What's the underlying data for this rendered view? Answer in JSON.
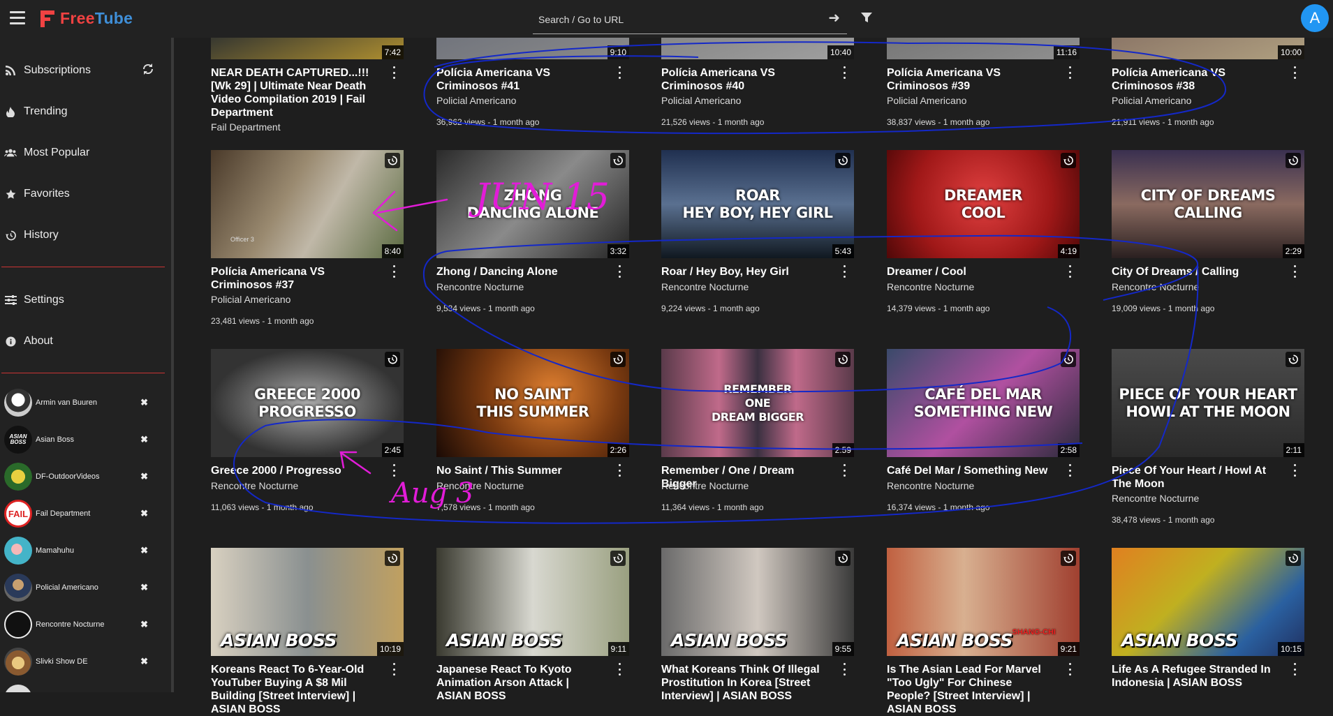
{
  "app": {
    "name_part1": "Free",
    "name_part2": "Tube"
  },
  "header": {
    "search_placeholder": "Search / Go to URL",
    "avatar_letter": "A"
  },
  "sidebar": {
    "nav": [
      {
        "label": "Subscriptions",
        "icon": "rss-icon"
      },
      {
        "label": "Trending",
        "icon": "fire-icon"
      },
      {
        "label": "Most Popular",
        "icon": "users-icon"
      },
      {
        "label": "Favorites",
        "icon": "star-icon"
      },
      {
        "label": "History",
        "icon": "history-icon"
      }
    ],
    "nav2": [
      {
        "label": "Settings",
        "icon": "sliders-icon"
      },
      {
        "label": "About",
        "icon": "info-icon"
      }
    ],
    "subscriptions": [
      {
        "name": "Armin van Buuren"
      },
      {
        "name": "Asian Boss"
      },
      {
        "name": "DF-OutdoorVideos"
      },
      {
        "name": "Fail Department"
      },
      {
        "name": "Mamahuhu"
      },
      {
        "name": "Policial Americano"
      },
      {
        "name": "Rencontre Nocturne"
      },
      {
        "name": "Slivki Show DE"
      }
    ]
  },
  "videos": [
    {
      "title": "NEAR DEATH CAPTURED...!!! [Wk 29] | Ultimate Near Death Video Compilation 2019 | Fail Department",
      "channel": "Fail Department",
      "meta": "",
      "duration": "7:42"
    },
    {
      "title": "Polícia Americana VS Criminosos #41",
      "channel": "Policial Americano",
      "meta": "36,962 views - 1 month ago",
      "duration": "9:10"
    },
    {
      "title": "Polícia Americana VS Criminosos #40",
      "channel": "Policial Americano",
      "meta": "21,526 views - 1 month ago",
      "duration": "10:40"
    },
    {
      "title": "Polícia Americana VS Criminosos #39",
      "channel": "Policial Americano",
      "meta": "38,837 views - 1 month ago",
      "duration": "11:16"
    },
    {
      "title": "Polícia Americana VS Criminosos #38",
      "channel": "Policial Americano",
      "meta": "21,911 views - 1 month ago",
      "duration": "10:00"
    },
    {
      "title": "Polícia Americana VS Criminosos #37",
      "channel": "Policial Americano",
      "meta": "23,481 views - 1 month ago",
      "duration": "8:40",
      "overlay": "",
      "overlay2": "Officer 3"
    },
    {
      "title": "Zhong / Dancing Alone",
      "channel": "Rencontre Nocturne",
      "meta": "9,534 views - 1 month ago",
      "duration": "3:32",
      "overlay": "ZHONG\nDANCING ALONE"
    },
    {
      "title": "Roar / Hey Boy, Hey Girl",
      "channel": "Rencontre Nocturne",
      "meta": "9,224 views - 1 month ago",
      "duration": "5:43",
      "overlay": "ROAR\nHEY BOY, HEY GIRL"
    },
    {
      "title": "Dreamer / Cool",
      "channel": "Rencontre Nocturne",
      "meta": "14,379 views - 1 month ago",
      "duration": "4:19",
      "overlay": "DREAMER\nCOOL"
    },
    {
      "title": "City Of Dreams / Calling",
      "channel": "Rencontre Nocturne",
      "meta": "19,009 views - 1 month ago",
      "duration": "2:29",
      "overlay": "CITY OF DREAMS\nCALLING"
    },
    {
      "title": "Greece 2000 / Progresso",
      "channel": "Rencontre Nocturne",
      "meta": "11,063 views - 1 month ago",
      "duration": "2:45",
      "overlay": "GREECE 2000\nPROGRESSO"
    },
    {
      "title": "No Saint / This Summer",
      "channel": "Rencontre Nocturne",
      "meta": "7,578 views - 1 month ago",
      "duration": "2:26",
      "overlay": "NO SAINT\nTHIS SUMMER"
    },
    {
      "title": "Remember / One / Dream Bigger",
      "channel": "Rencontre Nocturne",
      "meta": "11,364 views - 1 month ago",
      "duration": "2:59",
      "overlay": "REMEMBER\nONE\nDREAM BIGGER"
    },
    {
      "title": "Café Del Mar / Something New",
      "channel": "Rencontre Nocturne",
      "meta": "16,374 views - 1 month ago",
      "duration": "2:58",
      "overlay": "CAFÉ DEL MAR\nSOMETHING NEW"
    },
    {
      "title": "Piece Of Your Heart / Howl At The Moon",
      "channel": "Rencontre Nocturne",
      "meta": "38,478 views - 1 month ago",
      "duration": "2:11",
      "overlay": "PIECE OF YOUR HEART\nHOWL AT THE MOON"
    },
    {
      "title": "Koreans React To 6-Year-Old YouTuber Buying A $8 Mil Building [Street Interview] | ASIAN BOSS",
      "channel": "",
      "meta": "",
      "duration": "10:19",
      "overlay": "ASIAN BOSS"
    },
    {
      "title": "Japanese React To Kyoto Animation Arson Attack | ASIAN BOSS",
      "channel": "",
      "meta": "",
      "duration": "9:11",
      "overlay": "ASIAN BOSS"
    },
    {
      "title": "What Koreans Think Of Illegal Prostitution In Korea [Street Interview] | ASIAN BOSS",
      "channel": "",
      "meta": "",
      "duration": "9:55",
      "overlay": "ASIAN BOSS"
    },
    {
      "title": "Is The Asian Lead For Marvel \"Too Ugly\" For Chinese People? [Street Interview] | ASIAN BOSS",
      "channel": "",
      "meta": "",
      "duration": "9:21",
      "overlay": "ASIAN BOSS",
      "overlay2": "SHANG-CHI"
    },
    {
      "title": "Life As A Refugee Stranded In Indonesia | ASIAN BOSS",
      "channel": "",
      "meta": "",
      "duration": "10:15",
      "overlay": "ASIAN BOSS"
    }
  ],
  "annotations": {
    "text1": "JUN 15",
    "text2": "Aug 3"
  },
  "colors": {
    "brand_red": "#f04242",
    "brand_blue": "#3f8fd8",
    "avatar_blue": "#2196f3",
    "annotation_pink": "#e21cd8",
    "annotation_blue": "#1428c8"
  }
}
